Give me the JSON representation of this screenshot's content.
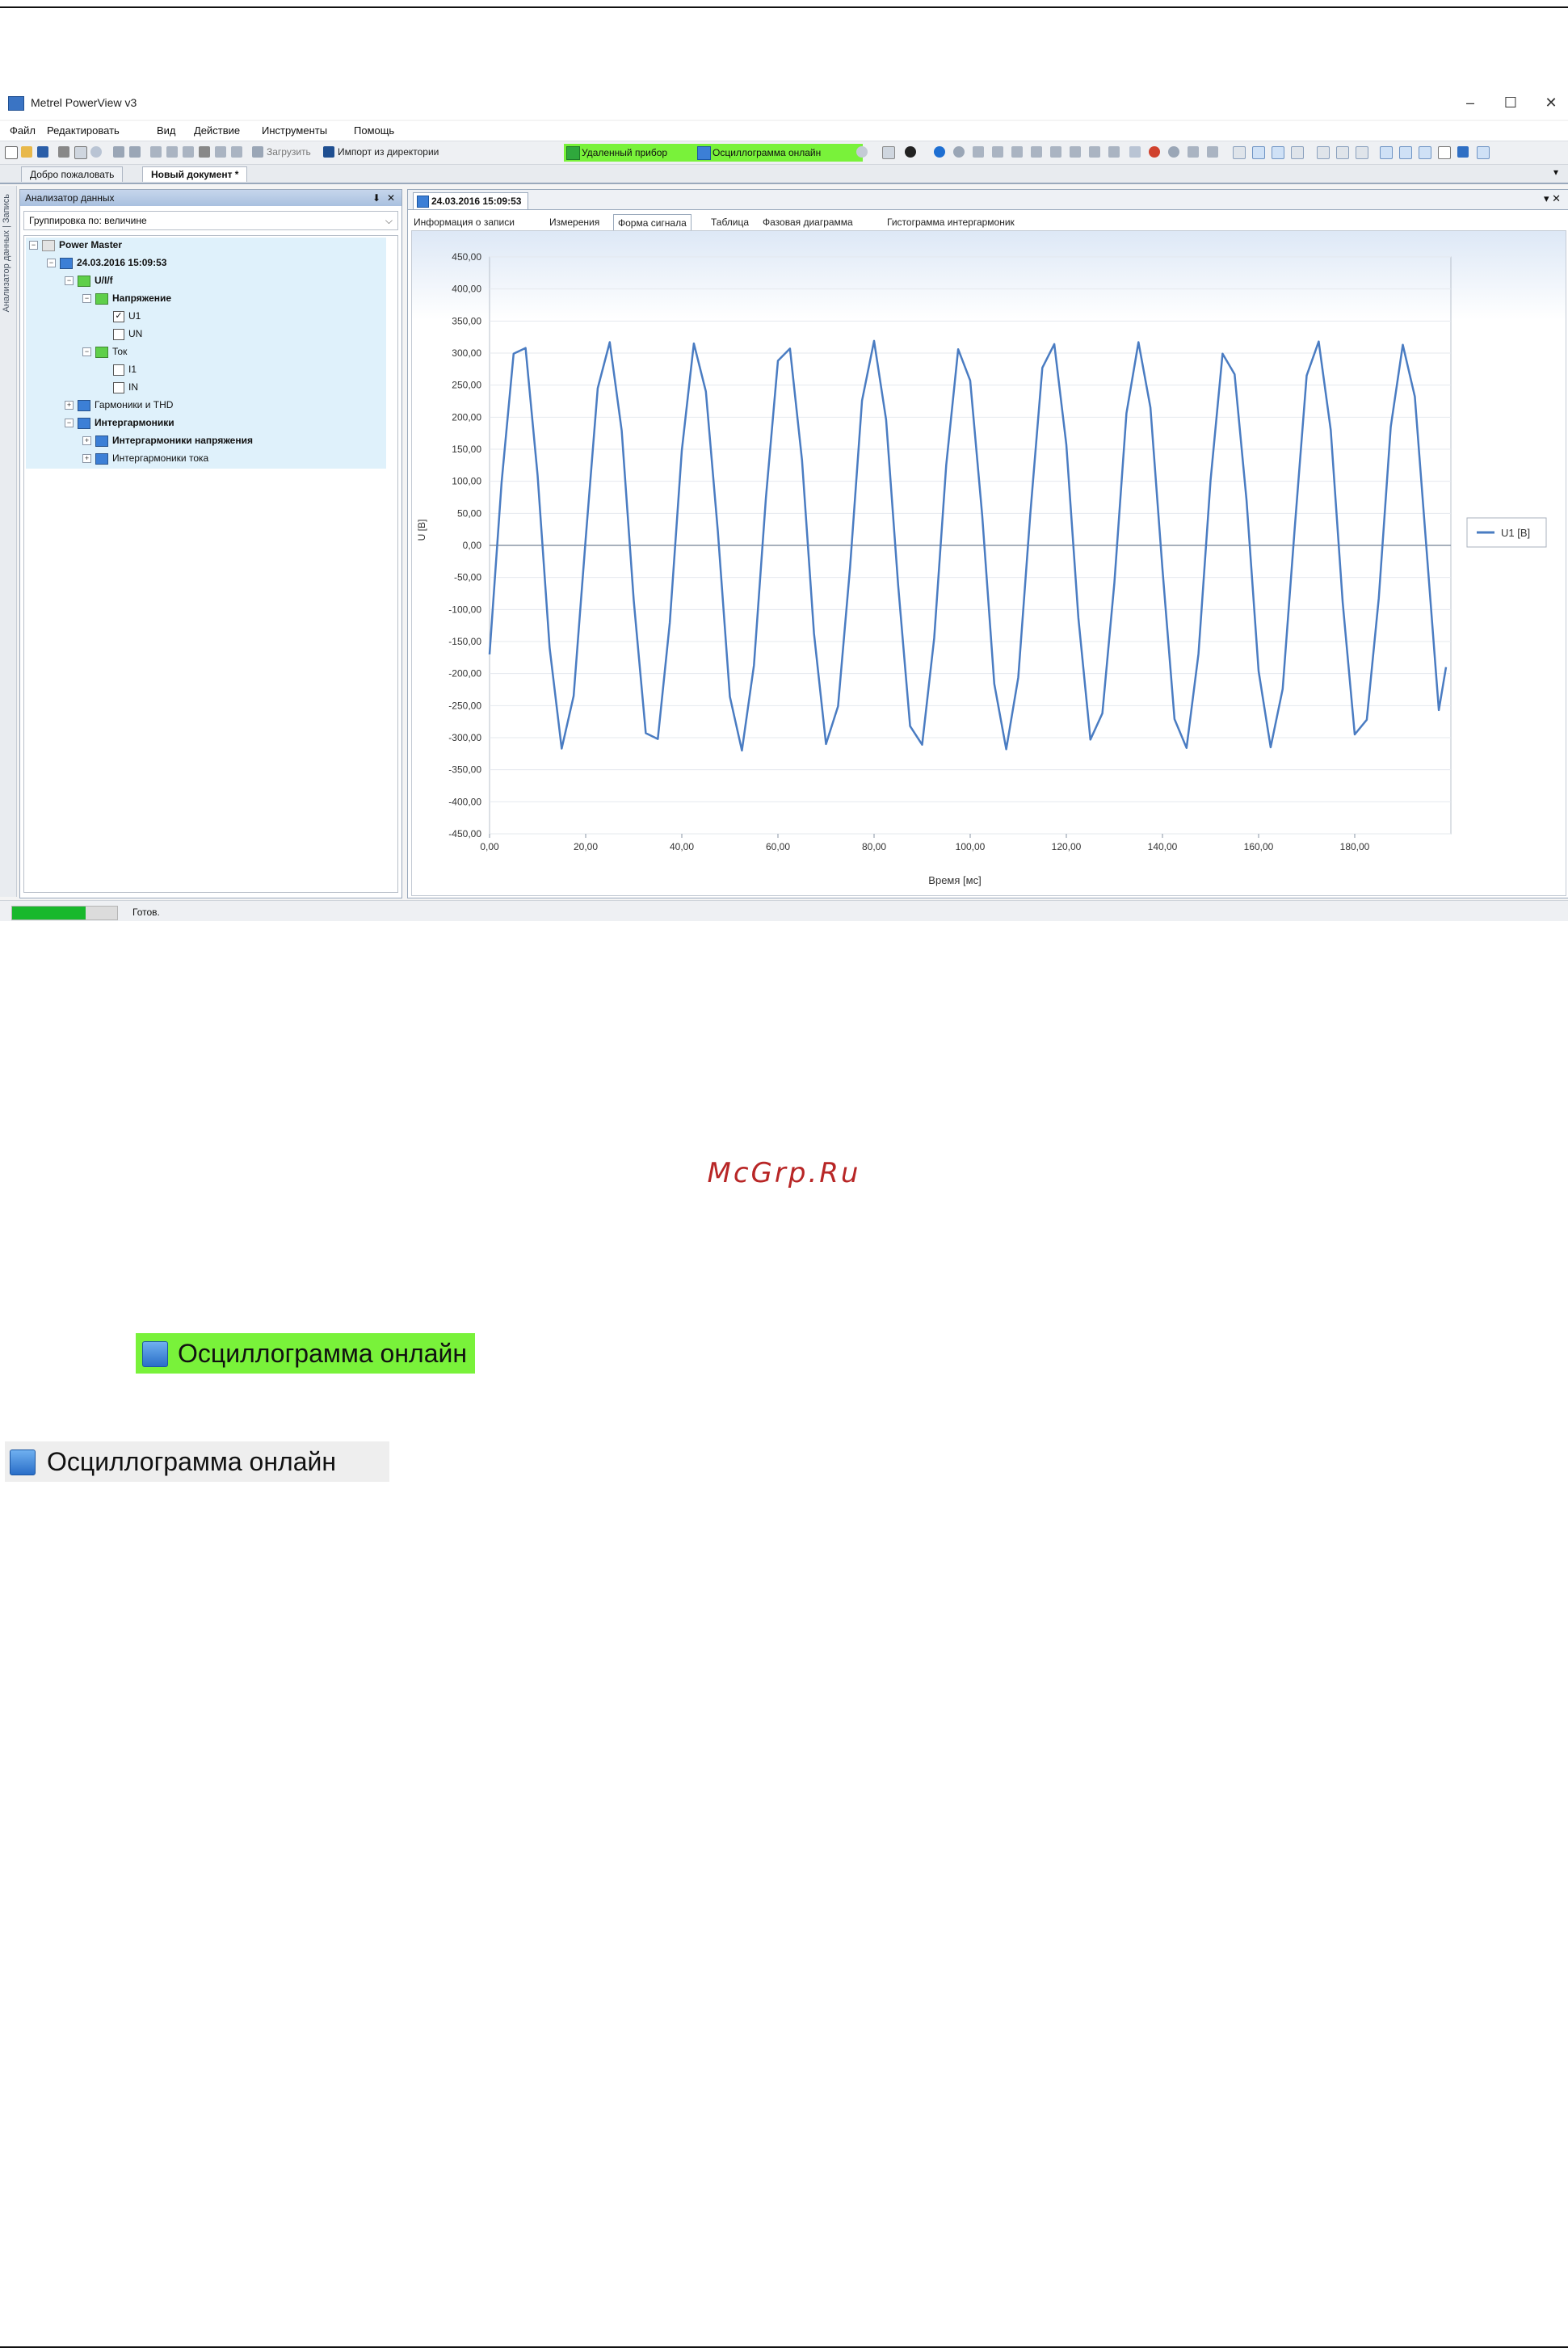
{
  "window": {
    "title": "Metrel PowerView v3",
    "controls": [
      "–",
      "☐",
      "✕"
    ]
  },
  "menu": [
    "Файл",
    "Редактировать",
    "Вид",
    "Действие",
    "Инструменты",
    "Помощь"
  ],
  "toolbar": {
    "upload_label": "Загрузить",
    "import_label": "Импорт из директории",
    "remote_label": "Удаленный прибор",
    "oscillogram_label": "Осциллограмма онлайн",
    "highlight_color": "#79f23a"
  },
  "doc_tabs": [
    "Добро пожаловать",
    "Новый документ *"
  ],
  "side_strip_text": "Анализатор данных | Запись",
  "panel": {
    "title": "Анализатор данных",
    "pin": "⬇",
    "close": "✕",
    "grouping": "Группировка по: величине"
  },
  "tree": {
    "root": "Power Master",
    "record": "24.03.2016 15:09:53",
    "group": "U/I/f",
    "voltage": "Напряжение",
    "u1": "U1",
    "un": "UN",
    "current": "Ток",
    "i1": "I1",
    "in": "IN",
    "harmonics": "Гармоники и THD",
    "interharmonics": "Интергармоники",
    "ih_voltage": "Интергармоники напряжения",
    "ih_current": "Интергармоники тока"
  },
  "document": {
    "tab": "24.03.2016 15:09:53",
    "controls": "▾ ✕",
    "subtabs": [
      "Информация о записи",
      "Измерения",
      "Форма сигнала",
      "Таблица",
      "Фазовая диаграмма",
      "Гистограмма интергармоник"
    ],
    "active_subtab": "Форма сигнала"
  },
  "chart_data": {
    "type": "line",
    "title": "",
    "xlabel": "Время [мс]",
    "ylabel": "U [В]",
    "xlim": [
      0,
      200
    ],
    "ylim": [
      -450,
      450
    ],
    "xticks": [
      "0,00",
      "20,00",
      "40,00",
      "60,00",
      "80,00",
      "100,00",
      "120,00",
      "140,00",
      "160,00",
      "180,00"
    ],
    "xtick_values": [
      0,
      20,
      40,
      60,
      80,
      100,
      120,
      140,
      160,
      180
    ],
    "yticks": [
      "450,00",
      "400,00",
      "350,00",
      "300,00",
      "250,00",
      "200,00",
      "150,00",
      "100,00",
      "50,00",
      "0,00",
      "-50,00",
      "-100,00",
      "-150,00",
      "-200,00",
      "-250,00",
      "-300,00",
      "-350,00",
      "-400,00",
      "-450,00"
    ],
    "ytick_values": [
      450,
      400,
      350,
      300,
      250,
      200,
      150,
      100,
      50,
      0,
      -50,
      -100,
      -150,
      -200,
      -250,
      -300,
      -350,
      -400,
      -450
    ],
    "series": [
      {
        "name": "U1 [В]",
        "color": "#4a7cc2",
        "x": [
          0,
          2.5,
          5,
          7.5,
          10,
          12.5,
          15,
          17.5,
          20,
          22.5,
          25,
          27.5,
          30,
          32.5,
          35,
          37.5,
          40,
          42.5,
          45,
          47.5,
          50,
          52.5,
          55,
          57.5,
          60,
          62.5,
          65,
          67.5,
          70,
          72.5,
          75,
          77.5,
          80,
          82.5,
          85,
          87.5,
          90,
          92.5,
          95,
          97.5,
          100,
          102.5,
          105,
          107.5,
          110,
          112.5,
          115,
          117.5,
          120,
          122.5,
          125,
          127.5,
          130,
          132.5,
          135,
          137.5,
          140,
          142.5,
          145,
          147.5,
          150,
          152.5,
          155,
          157.5,
          160,
          162.5,
          165,
          167.5,
          170,
          172.5,
          175,
          177.5,
          180,
          182.5,
          185,
          187.5,
          190,
          192.5,
          195,
          197.5,
          199
        ],
        "y": [
          -170,
          98,
          299,
          308,
          109,
          -160,
          -317,
          -235,
          10,
          245,
          317,
          179,
          -86,
          -293,
          -302,
          -121,
          148,
          315,
          240,
          22,
          -236,
          -320,
          -187,
          74,
          288,
          307,
          133,
          -137,
          -310,
          -251,
          -34,
          226,
          319,
          196,
          -62,
          -282,
          -311,
          -145,
          125,
          306,
          257,
          46,
          -216,
          -318,
          -206,
          49,
          277,
          314,
          157,
          -113,
          -303,
          -262,
          -58,
          206,
          317,
          215,
          -37,
          -271,
          -316,
          -169,
          101,
          299,
          267,
          70,
          -196,
          -315,
          -224,
          25,
          265,
          318,
          180,
          -89,
          -295,
          -272,
          -82,
          185,
          313,
          232,
          -13,
          -257,
          -190
        ]
      }
    ],
    "legend_position": "right",
    "grid": true
  },
  "status": {
    "progress": 0.7,
    "text": "Готов."
  },
  "watermark": "McGrp.Ru",
  "samples": {
    "highlighted": "Осциллограмма онлайн",
    "plain": "Осциллограмма онлайн"
  }
}
